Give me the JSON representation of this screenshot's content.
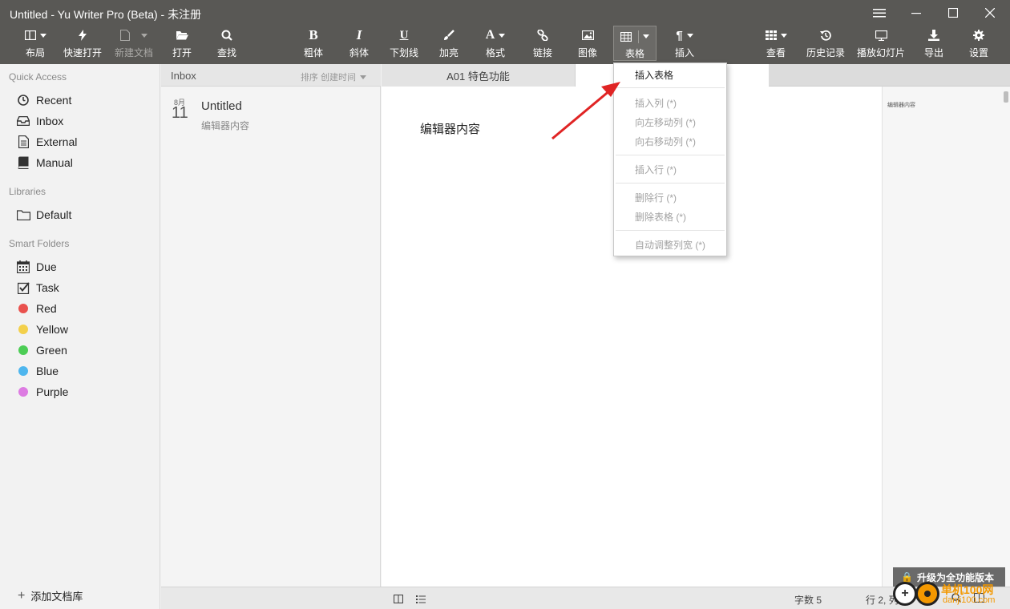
{
  "window": {
    "title": "Untitled - Yu Writer Pro (Beta) - 未注册"
  },
  "toolbar": {
    "layout": "布局",
    "quick_open": "快速打开",
    "new_doc": "新建文档",
    "open": "打开",
    "find": "查找",
    "bold": "粗体",
    "italic": "斜体",
    "underline": "下划线",
    "highlight": "加亮",
    "format": "格式",
    "link": "链接",
    "image": "图像",
    "table": "表格",
    "insert": "插入",
    "view": "查看",
    "history": "历史记录",
    "slideshow": "播放幻灯片",
    "export": "导出",
    "settings": "设置",
    "bold_glyph": "B",
    "italic_glyph": "I",
    "underline_glyph": "U",
    "format_glyph": "A",
    "insert_glyph": "¶"
  },
  "sidebar": {
    "quick_access": "Quick Access",
    "qa_items": [
      "Recent",
      "Inbox",
      "External",
      "Manual"
    ],
    "libraries": "Libraries",
    "lib_items": [
      "Default"
    ],
    "smart_folders": "Smart Folders",
    "sf_items": [
      "Due",
      "Task",
      "Red",
      "Yellow",
      "Green",
      "Blue",
      "Purple"
    ],
    "add_library": "添加文档库"
  },
  "colors": {
    "red": "#e9514d",
    "yellow": "#f3d04b",
    "green": "#4ccd55",
    "blue": "#4eb6ee",
    "purple": "#dd7ce2",
    "toolbar_bg": "#595855",
    "arrow": "#e02424"
  },
  "doclist": {
    "folder": "Inbox",
    "sort_label": "排序 创建时间",
    "items": [
      {
        "month": "8月",
        "day": "11",
        "title": "Untitled",
        "snippet": "编辑器内容"
      }
    ]
  },
  "editor": {
    "tabs": [
      "A01 特色功能"
    ],
    "content": "编辑器内容",
    "minimap_text": "编辑器内容"
  },
  "table_menu": {
    "items": [
      {
        "label": "插入表格",
        "enabled": true
      },
      {
        "label": "插入列 (*)",
        "enabled": false
      },
      {
        "label": "向左移动列 (*)",
        "enabled": false
      },
      {
        "label": "向右移动列 (*)",
        "enabled": false
      },
      {
        "label": "插入行 (*)",
        "enabled": false
      },
      {
        "label": "删除行 (*)",
        "enabled": false
      },
      {
        "label": "删除表格 (*)",
        "enabled": false
      },
      {
        "label": "自动调整列宽 (*)",
        "enabled": false
      }
    ]
  },
  "status": {
    "word_count": "字数 5",
    "line": "行 2, 列"
  },
  "upgrade_banner": "升级为全功能版本",
  "watermark": {
    "site": "单机100网",
    "domain": "danji100.com"
  }
}
